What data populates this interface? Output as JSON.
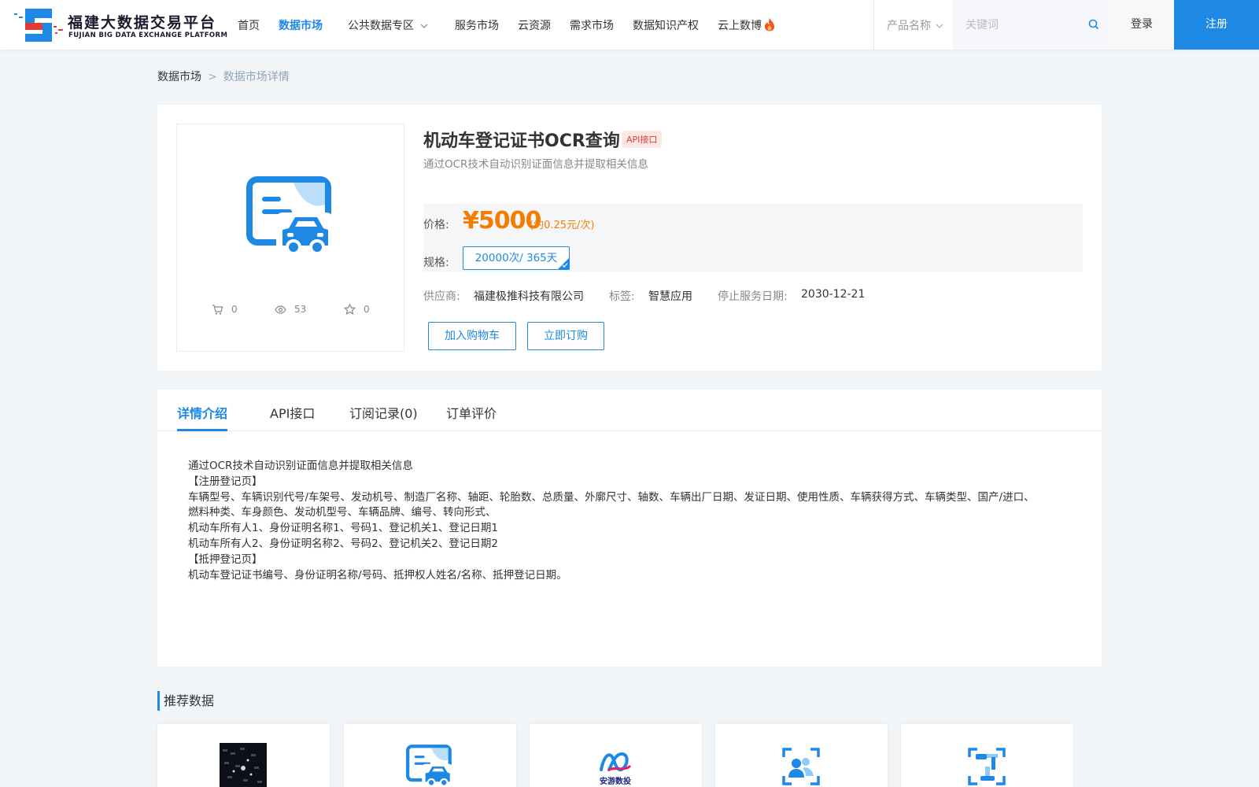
{
  "header": {
    "logo_cn": "福建大数据交易平台",
    "logo_en": "FUJIAN BIG DATA EXCHANGE  PLATFORM",
    "nav": [
      {
        "label": "首页"
      },
      {
        "label": "数据市场"
      },
      {
        "label": "公共数据专区"
      },
      {
        "label": "服务市场"
      },
      {
        "label": "云资源"
      },
      {
        "label": "需求市场"
      },
      {
        "label": "数据知识产权"
      },
      {
        "label": "云上数博"
      }
    ],
    "search": {
      "category": "产品名称",
      "placeholder": "关键词"
    },
    "login": "登录",
    "register": "注册"
  },
  "breadcrumb": {
    "root": "数据市场",
    "sep": ">",
    "current": "数据市场详情"
  },
  "product": {
    "title": "机动车登记证书OCR查询",
    "badge": "API接口",
    "subtitle": "通过OCR技术自动识别证面信息并提取相关信息",
    "stats": {
      "cart": "0",
      "views": "53",
      "favorites": "0"
    },
    "price_label": "价格:",
    "price": "¥5000",
    "price_per": "(约0.25元/次)",
    "spec_label": "规格:",
    "spec": "20000次/ 365天",
    "supplier_label": "供应商:",
    "supplier": "福建极推科技有限公司",
    "tag_label": "标签:",
    "tag": "智慧应用",
    "stop_label": "停止服务日期:",
    "stop_date": "2030-12-21",
    "add_cart": "加入购物车",
    "subscribe": "立即订购"
  },
  "tabs": [
    {
      "label": "详情介绍"
    },
    {
      "label": "API接口"
    },
    {
      "label": "订阅记录(0)"
    },
    {
      "label": "订单评价"
    }
  ],
  "detail_lines": [
    "通过OCR技术自动识别证面信息并提取相关信息",
    "【注册登记页】",
    "车辆型号、车辆识别代号/车架号、发动机号、制造厂名称、轴距、轮胎数、总质量、外廓尺寸、轴数、车辆出厂日期、发证日期、使用性质、车辆获得方式、车辆类型、国产/进口、",
    "燃料种类、车身颜色、发动机型号、车辆品牌、编号、转向形式、",
    "机动车所有人1、身份证明名称1、号码1、登记机关1、登记日期1",
    "机动车所有人2、身份证明名称2、号码2、登记机关2、登记日期2",
    "【抵押登记页】",
    "机动车登记证书编号、身份证明名称/号码、抵押权人姓名/名称、抵押登记日期。"
  ],
  "recommend": {
    "title": "推荐数据",
    "items": [
      {
        "icon": "circuit-photo-icon"
      },
      {
        "icon": "vehicle-card-icon"
      },
      {
        "icon": "anyou-logo-icon",
        "logo_text": "安游数投"
      },
      {
        "icon": "face-scan-icon"
      },
      {
        "icon": "robot-arm-scan-icon"
      }
    ]
  },
  "colors": {
    "primary": "#1e88e5",
    "price": "#f57c00",
    "badge_bg": "#fde8e8",
    "badge_text": "#e53935",
    "page_bg": "#f2f5f8"
  }
}
